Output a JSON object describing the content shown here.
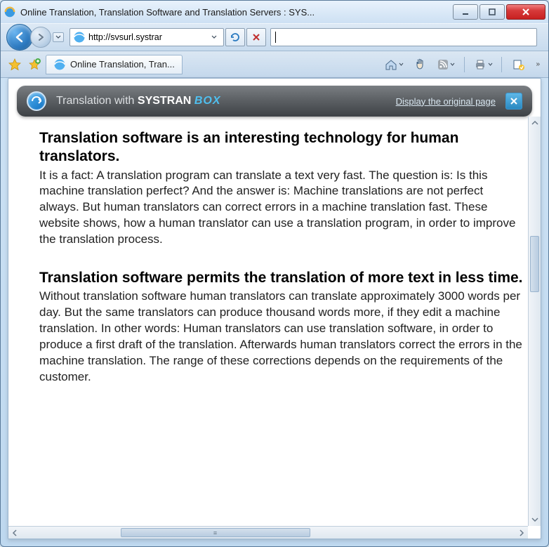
{
  "window": {
    "title": "Online Translation, Translation Software and Translation Servers : SYS..."
  },
  "address": {
    "url": "http://svsurl.systrar"
  },
  "tab": {
    "label": "Online Translation, Tran..."
  },
  "systran": {
    "prefix": "Translation with ",
    "brand": "SYSTRAN",
    "box": "BOX",
    "link": "Display the original page"
  },
  "article": {
    "h1": "Translation software is an interesting technology for human translators.",
    "p1": "It is a fact: A translation program can translate a text very fast. The question is: Is this machine translation perfect? And the answer is: Machine translations are not perfect always. But human translators can correct errors in a machine translation fast. These website shows, how a human translator can use a translation program, in order to improve the translation process.",
    "h2": "Translation software permits the translation of more text in less time.",
    "p2": "Without translation software human translators can translate approximately 3000 words per day. But the same translators can produce thousand words more, if they edit a machine translation. In other words: Human translators can use translation software, in order to produce a first draft of the translation. Afterwards human translators correct the errors in the machine translation. The range of these corrections depends on the requirements of the customer."
  }
}
